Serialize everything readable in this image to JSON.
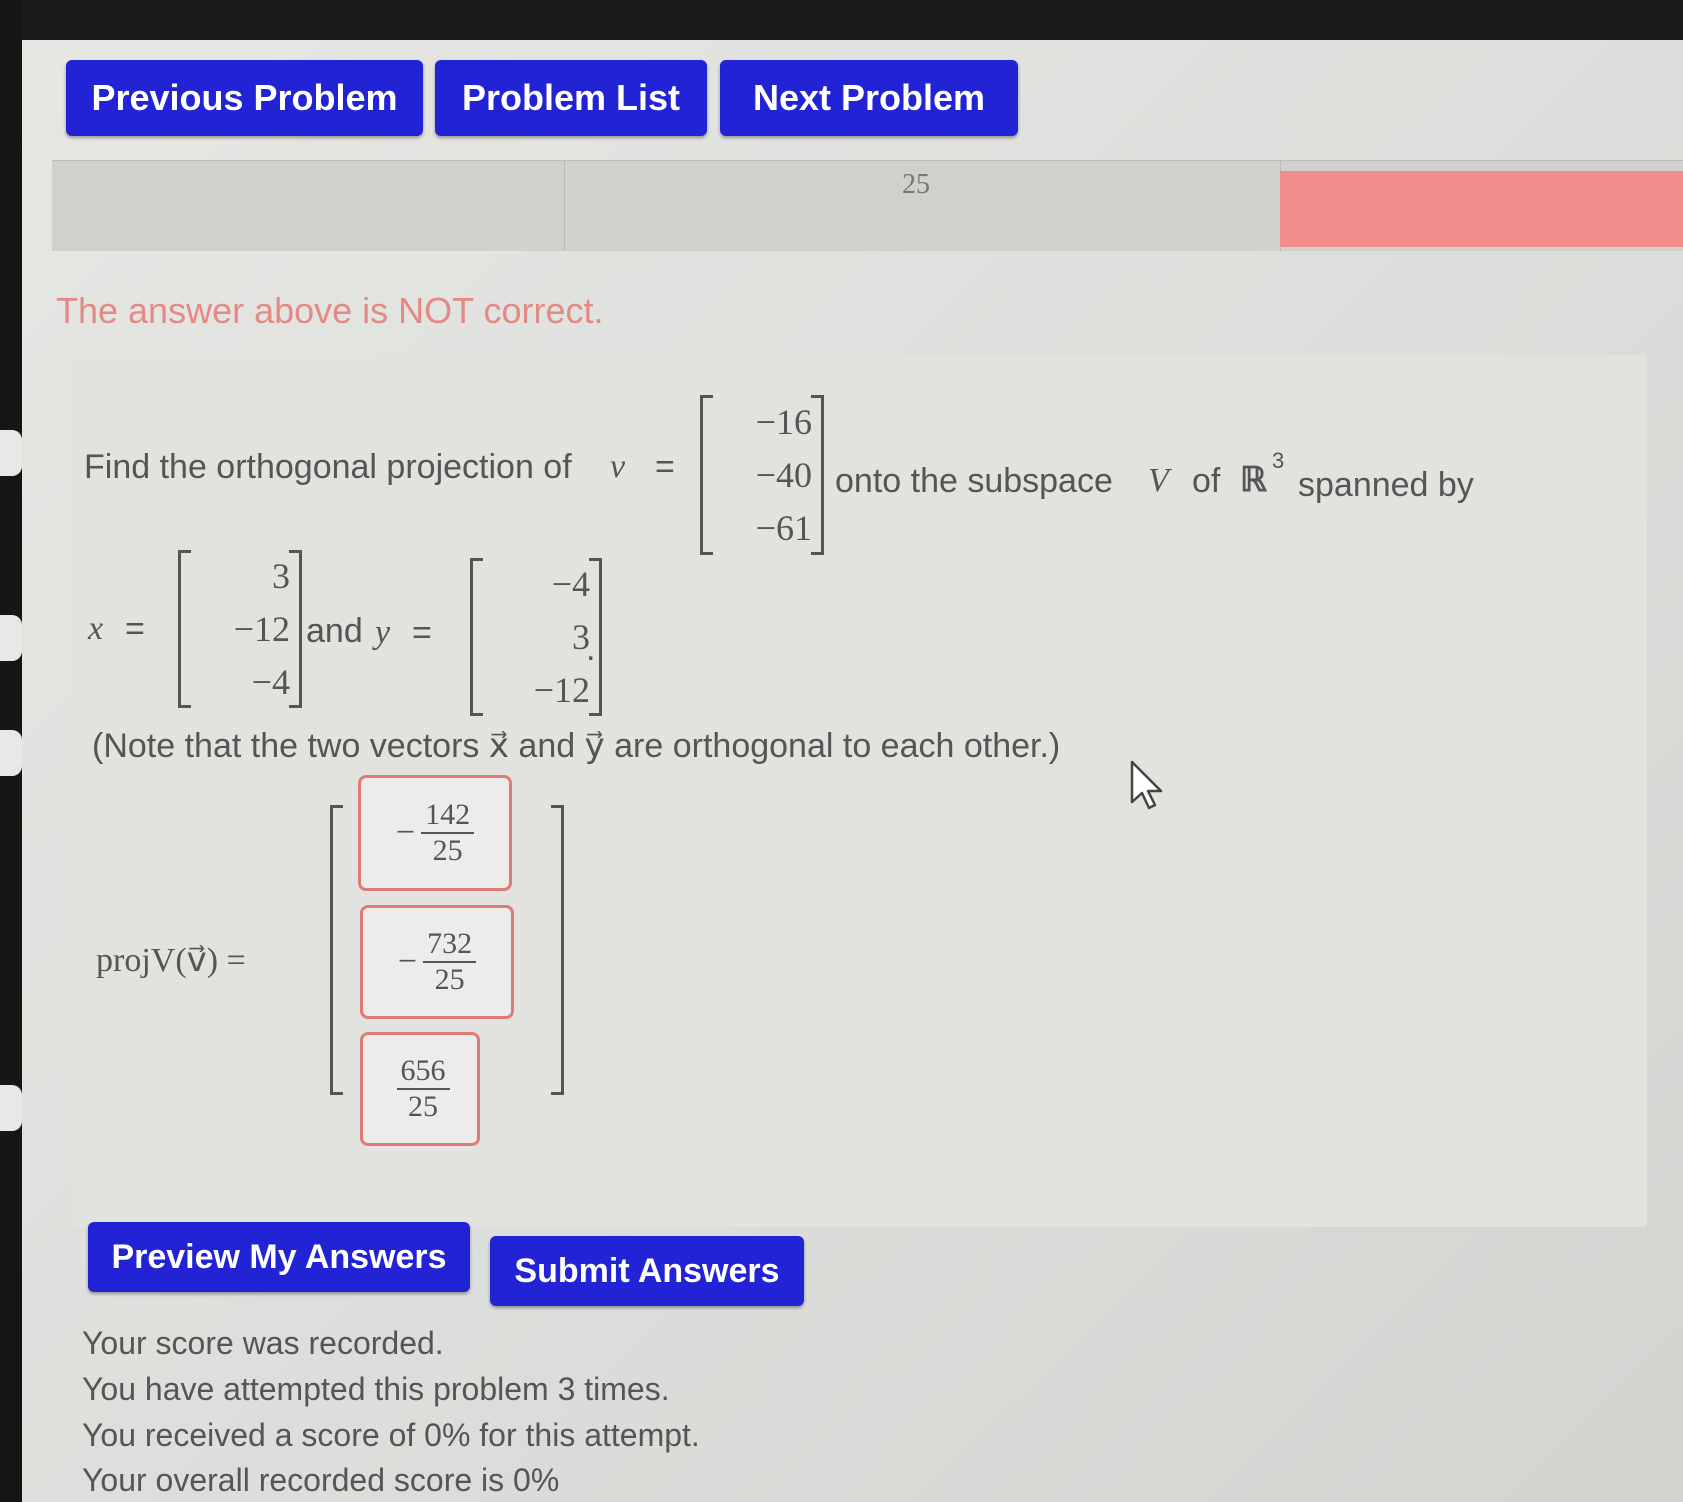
{
  "nav": {
    "previous_label": "Previous Problem",
    "list_label": "Problem List",
    "next_label": "Next Problem"
  },
  "prior_answer_fragment": "25",
  "feedback": "The answer above is NOT correct.",
  "problem": {
    "intro": "Find the orthogonal projection of",
    "v_label": "v⃗",
    "equals": "=",
    "v": [
      "−16",
      "−40",
      "−61"
    ],
    "onto_text": "onto the subspace",
    "V": "V",
    "of_text": "of",
    "R3": "ℝ",
    "R3_sup": "3",
    "spanned_text": "spanned by",
    "x_label": "x⃗",
    "x": [
      "3",
      "−12",
      "−4"
    ],
    "and_text": "and",
    "y_label": "y⃗",
    "y": [
      "−4",
      "3",
      "−12"
    ],
    "period": ".",
    "note": "(Note that the two vectors x⃗ and y⃗ are orthogonal to each other.)",
    "proj_label": "projV(v⃗) ="
  },
  "answers": [
    {
      "sign": "−",
      "num": "142",
      "den": "25"
    },
    {
      "sign": "−",
      "num": "732",
      "den": "25"
    },
    {
      "sign": "",
      "num": "656",
      "den": "25"
    }
  ],
  "buttons": {
    "preview_label": "Preview My Answers",
    "submit_label": "Submit Answers"
  },
  "score": {
    "line1": "Your score was recorded.",
    "line2": "You have attempted this problem 3 times.",
    "line3": "You received a score of 0% for this attempt.",
    "line4": "Your overall recorded score is 0%"
  },
  "colors": {
    "button_blue": "#2323d6",
    "error_red": "#e48a86"
  }
}
